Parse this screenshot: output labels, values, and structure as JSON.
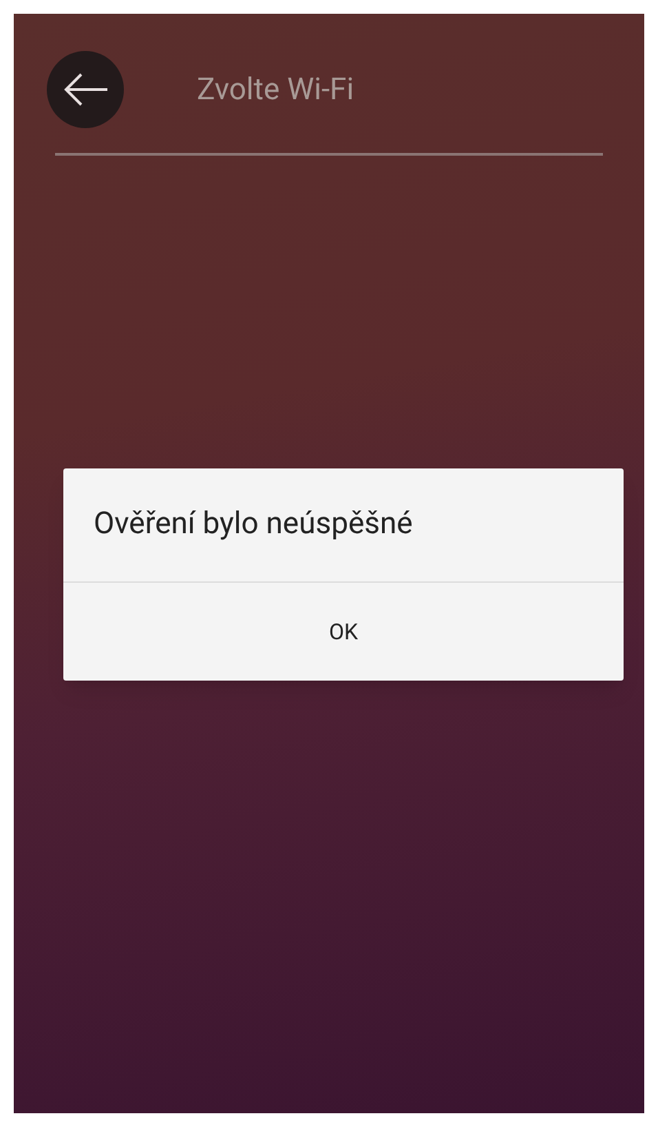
{
  "header": {
    "title": "Zvolte Wi-Fi"
  },
  "dialog": {
    "message": "Ověření bylo neúspěšné",
    "buttons": [
      "OK"
    ]
  }
}
